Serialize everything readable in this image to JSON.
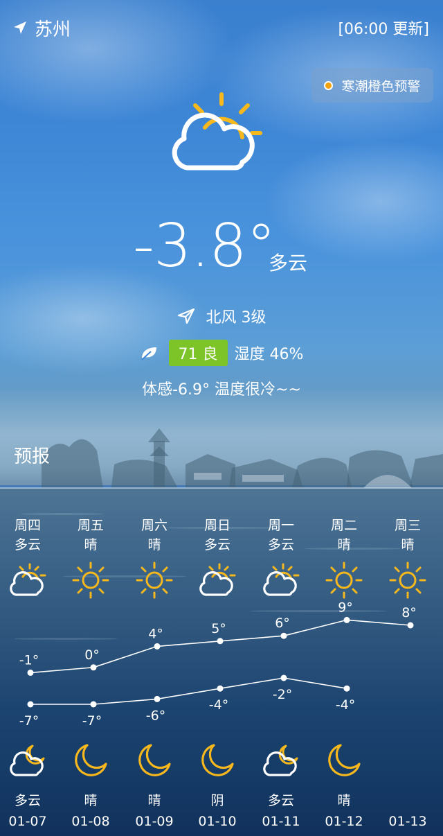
{
  "header": {
    "city": "苏州",
    "updated": "[06:00 更新]",
    "alert": "寒潮橙色预警"
  },
  "current": {
    "temperature": "-3.8°",
    "condition": "多云",
    "wind": "北风 3级",
    "aqi": "71 良",
    "humidity": "湿度 46%",
    "feels_like": "体感-6.9° 温度很冷~~"
  },
  "forecast": {
    "title": "预报",
    "days": [
      {
        "weekday": "周四",
        "day_cond": "多云",
        "day_icon": "partly-cloudy-icon",
        "high": "-1°",
        "low": "-7°",
        "night_icon": "cloud-moon-icon",
        "night_cond": "多云",
        "date": "01-07"
      },
      {
        "weekday": "周五",
        "day_cond": "晴",
        "day_icon": "sun-icon",
        "high": "0°",
        "low": "-7°",
        "night_icon": "moon-icon",
        "night_cond": "晴",
        "date": "01-08"
      },
      {
        "weekday": "周六",
        "day_cond": "晴",
        "day_icon": "sun-icon",
        "high": "4°",
        "low": "-6°",
        "night_icon": "moon-icon",
        "night_cond": "晴",
        "date": "01-09"
      },
      {
        "weekday": "周日",
        "day_cond": "多云",
        "day_icon": "partly-cloudy-icon",
        "high": "5°",
        "low": "-4°",
        "night_icon": "moon-icon",
        "night_cond": "阴",
        "date": "01-10"
      },
      {
        "weekday": "周一",
        "day_cond": "多云",
        "day_icon": "partly-cloudy-icon",
        "high": "6°",
        "low": "-2°",
        "night_icon": "cloud-moon-icon",
        "night_cond": "多云",
        "date": "01-11"
      },
      {
        "weekday": "周二",
        "day_cond": "晴",
        "day_icon": "sun-icon",
        "high": "9°",
        "low": "-4°",
        "night_icon": "moon-icon",
        "night_cond": "晴",
        "date": "01-12"
      },
      {
        "weekday": "周三",
        "day_cond": "晴",
        "day_icon": "sun-icon",
        "high": "8°",
        "low": "",
        "night_icon": "",
        "night_cond": "",
        "date": "01-13"
      }
    ]
  },
  "chart_data": {
    "type": "line",
    "categories": [
      "01-07",
      "01-08",
      "01-09",
      "01-10",
      "01-11",
      "01-12",
      "01-13"
    ],
    "series": [
      {
        "values": [
          -1,
          0,
          4,
          5,
          6,
          9,
          8
        ]
      },
      {
        "values": [
          -7,
          -7,
          -6,
          -4,
          -2,
          -4,
          null
        ]
      }
    ]
  },
  "colors": {
    "sun": "#f6b81c",
    "aqi_good": "#7cc427",
    "alert_dot": "#f3a20d"
  }
}
